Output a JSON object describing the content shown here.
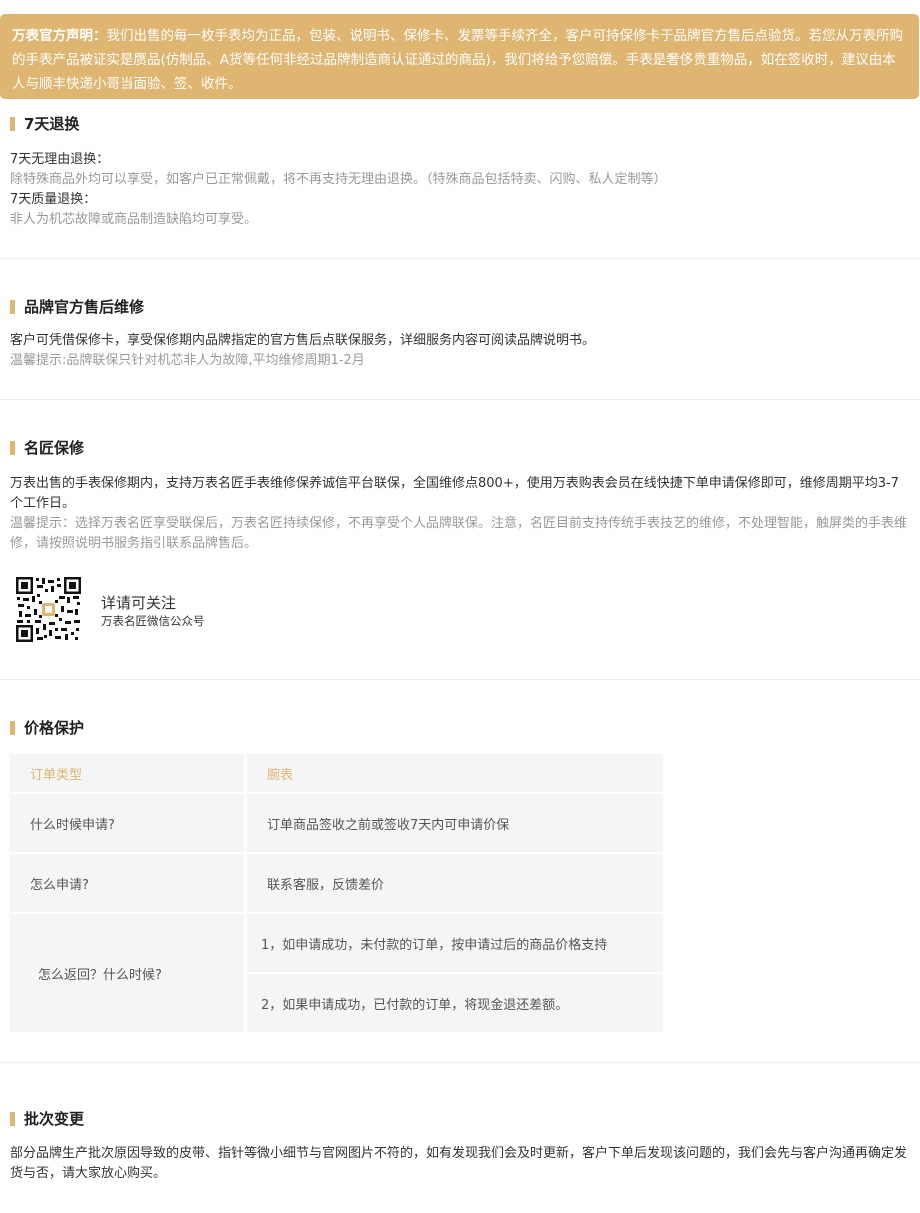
{
  "notice": {
    "label": "万表官方声明：",
    "text": "我们出售的每一枚手表均为正品，包装、说明书、保修卡、发票等手续齐全，客户可持保修卡于品牌官方售后点验货。若您从万表所购的手表产品被证实是赝品(仿制品、A货等任何非经过品牌制造商认证通过的商品)，我们将给予您赔偿。手表是奢侈贵重物品，如在签收时，建议由本人与顺丰快递小哥当面验、签、收件。"
  },
  "return7": {
    "title": "7天退换",
    "line1": "7天无理由退换：",
    "line2": "除特殊商品外均可以享受，如客户已正常佩戴，将不再支持无理由退换。（特殊商品包括特卖、闪购、私人定制等）",
    "line3": "7天质量退换：",
    "line4": "非人为机芯故障或商品制造缺陷均可享受。"
  },
  "brand_repair": {
    "title": "品牌官方售后维修",
    "line1": "客户可凭借保修卡，享受保修期内品牌指定的官方售后点联保服务，详细服务内容可阅读品牌说明书。",
    "line2": "温馨提示:品牌联保只针对机芯非人为故障,平均维修周期1-2月"
  },
  "master_repair": {
    "title": "名匠保修",
    "line1": "万表出售的手表保修期内，支持万表名匠手表维修保养诚信平台联保，全国维修点800+，使用万表购表会员在线快捷下单申请保修即可，维修周期平均3-7个工作日。",
    "line2": "温馨提示：选择万表名匠享受联保后，万表名匠持续保修，不再享受个人品牌联保。注意，名匠目前支持传统手表技艺的维修，不处理智能，触屏类的手表维修，请按照说明书服务指引联系品牌售后。",
    "qr_title": "详请可关注",
    "qr_subtitle": "万表名匠微信公众号"
  },
  "price_protect": {
    "title": "价格保护",
    "head": [
      "订单类型",
      "腕表"
    ],
    "rows": [
      [
        "什么时候申请?",
        "订单商品签收之前或签收7天内可申请价保"
      ],
      [
        "怎么申请?",
        "联系客服，反馈差价"
      ]
    ],
    "refund_q": "怎么返回？什么时候?",
    "refund_a1": "1，如申请成功，未付款的订单，按申请过后的商品价格支持",
    "refund_a2": "2，如果申请成功，已付款的订单，将现金退还差额。"
  },
  "batch": {
    "title": "批次变更",
    "text": "部分品牌生产批次原因导致的皮带、指针等微小细节与官网图片不符的，如有发现我们会及时更新，客户下单后发现该问题的，我们会先与客户沟通再确定发货与否，请大家放心购买。"
  },
  "colors": {
    "accent": "#dfb572",
    "cell_bg": "#f5f5f5",
    "muted_text": "#999999"
  }
}
